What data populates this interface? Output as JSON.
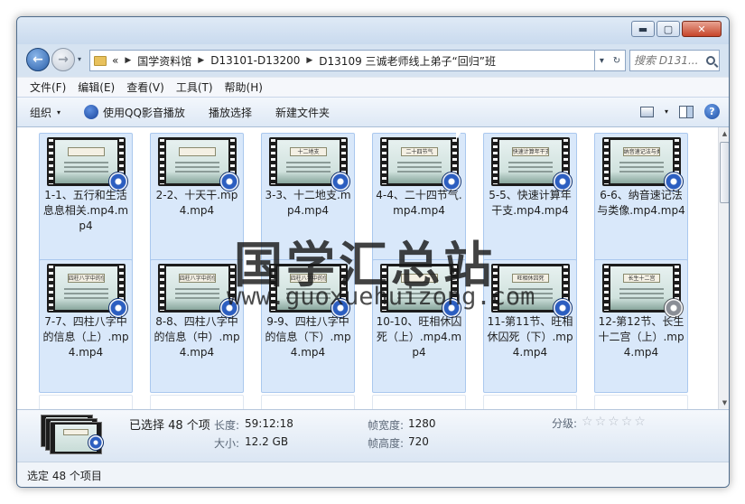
{
  "window": {
    "caption_buttons": {
      "minimize": "▬",
      "maximize": "▢",
      "close": "✕"
    }
  },
  "nav": {
    "back_glyph": "←",
    "forward_glyph": "→",
    "history_glyph": "▾",
    "overflow": "«",
    "breadcrumb": [
      "国学资料馆",
      "D13101-D13200",
      "D13109 三诚老师线上弟子“回归”班"
    ],
    "address_dropdown_glyph": "▾",
    "refresh_glyph": "↻",
    "search_placeholder": "搜索 D131..."
  },
  "menu": [
    "文件(F)",
    "编辑(E)",
    "查看(V)",
    "工具(T)",
    "帮助(H)"
  ],
  "toolbar": {
    "organize": "组织",
    "play_qq": "使用QQ影音播放",
    "play_selection": "播放选择",
    "new_folder": "新建文件夹",
    "caret": "▾",
    "help_glyph": "?"
  },
  "files": [
    {
      "label": "1-1、五行和生活息息相关.mp4.mp4",
      "slide_title": "",
      "icon": "play-icon"
    },
    {
      "label": "2-2、十天干.mp4.mp4",
      "slide_title": "",
      "icon": "play-icon"
    },
    {
      "label": "3-3、十二地支.mp4.mp4",
      "slide_title": "十二地支",
      "icon": "play-icon"
    },
    {
      "label": "4-4、二十四节气.mp4.mp4",
      "slide_title": "二十四节气",
      "icon": "play-icon"
    },
    {
      "label": "5-5、快速计算年干支.mp4.mp4",
      "slide_title": "快速计算年干支",
      "icon": "play-icon"
    },
    {
      "label": "6-6、纳音速记法与类像.mp4.mp4",
      "slide_title": "纳音速记法与类象",
      "icon": "play-icon"
    },
    {
      "label": "7-7、四柱八字中的信息（上）.mp4.mp4",
      "slide_title": "四柱八字中的信息",
      "icon": "play-icon"
    },
    {
      "label": "8-8、四柱八字中的信息（中）.mp4.mp4",
      "slide_title": "四柱八字中的信息",
      "icon": "play-icon"
    },
    {
      "label": "9-9、四柱八字中的信息（下）.mp4.mp4",
      "slide_title": "四柱八字中的信息",
      "icon": "play-icon"
    },
    {
      "label": "10-10、旺相休囚死（上）.mp4.mp4",
      "slide_title": "",
      "icon": "play-icon"
    },
    {
      "label": "11-第11节、旺相休囚死（下）.mp4.mp4",
      "slide_title": "旺相休囚死",
      "icon": "play-icon"
    },
    {
      "label": "12-第12节、长生十二宫（上）.mp4.mp4",
      "slide_title": "长生十二宫",
      "icon": "play-icon-gray"
    }
  ],
  "watermark": {
    "name": "国学汇总站",
    "url": "www.guoxuehuizong.com"
  },
  "details": {
    "selected": "已选择 48 个项",
    "length_label": "长度:",
    "length_value": "59:12:18",
    "size_label": "大小:",
    "size_value": "12.2 GB",
    "frame_width_label": "帧宽度:",
    "frame_width_value": "1280",
    "frame_height_label": "帧高度:",
    "frame_height_value": "720",
    "rating_label": "分级:",
    "rating_value": 0,
    "star_glyph": "☆"
  },
  "status": {
    "text": "选定 48 个项目"
  }
}
